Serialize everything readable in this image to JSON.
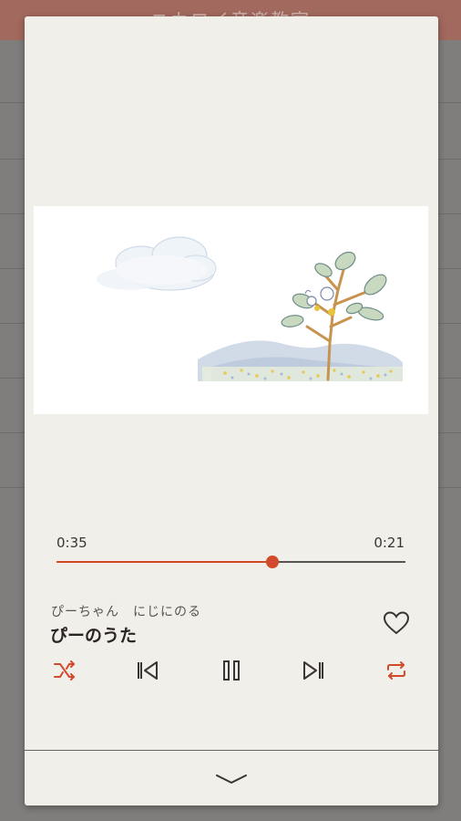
{
  "background_app": {
    "title": "ニカロイ音楽教室"
  },
  "player": {
    "elapsed": "0:35",
    "remaining": "0:21",
    "progress": 0.62,
    "artist": "ぴーちゃん　にじにのる",
    "song_title": "ぴーのうた",
    "favorite": false,
    "controls": {
      "shuffle_icon": "shuffle-icon",
      "previous_icon": "skip-previous-icon",
      "playpause_icon": "pause-icon",
      "next_icon": "skip-next-icon",
      "repeat_icon": "repeat-icon"
    },
    "collapse_icon": "chevron-down-icon",
    "accent_color": "#d24a2c"
  }
}
